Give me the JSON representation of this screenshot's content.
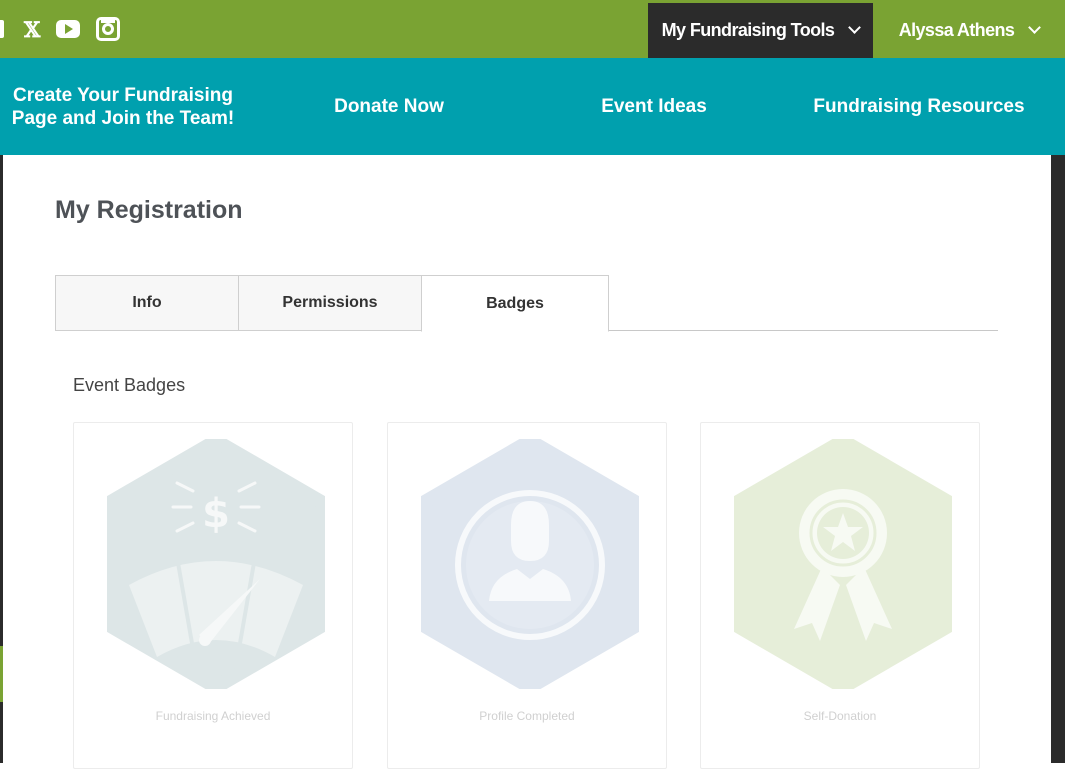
{
  "social": {
    "icons": [
      "facebook-icon",
      "x-icon",
      "youtube-icon",
      "instagram-icon"
    ],
    "x_glyph": "𝕏"
  },
  "topbar": {
    "tools_label": "My Fundraising Tools",
    "user_label": "Alyssa Athens"
  },
  "nav": {
    "items": [
      {
        "label": "Create Your Fundraising Page and Join the Team!"
      },
      {
        "label": "Donate Now"
      },
      {
        "label": "Event Ideas"
      },
      {
        "label": "Fundraising Resources"
      }
    ]
  },
  "page": {
    "title": "My Registration"
  },
  "tabs": {
    "items": [
      {
        "label": "Info"
      },
      {
        "label": "Permissions"
      },
      {
        "label": "Badges",
        "active": true
      }
    ]
  },
  "badges": {
    "section_title": "Event Badges",
    "items": [
      {
        "label": "Fundraising Achieved",
        "icon": "fundraising-gauge-icon",
        "color": "#dde6e7"
      },
      {
        "label": "Profile Completed",
        "icon": "profile-user-icon",
        "color": "#dfe6ef"
      },
      {
        "label": "Self-Donation",
        "icon": "award-ribbon-icon",
        "color": "#e6eed9"
      }
    ]
  },
  "colors": {
    "topbar_green": "#7aa333",
    "nav_teal": "#00a0ae",
    "dark": "#2b2b2b"
  }
}
